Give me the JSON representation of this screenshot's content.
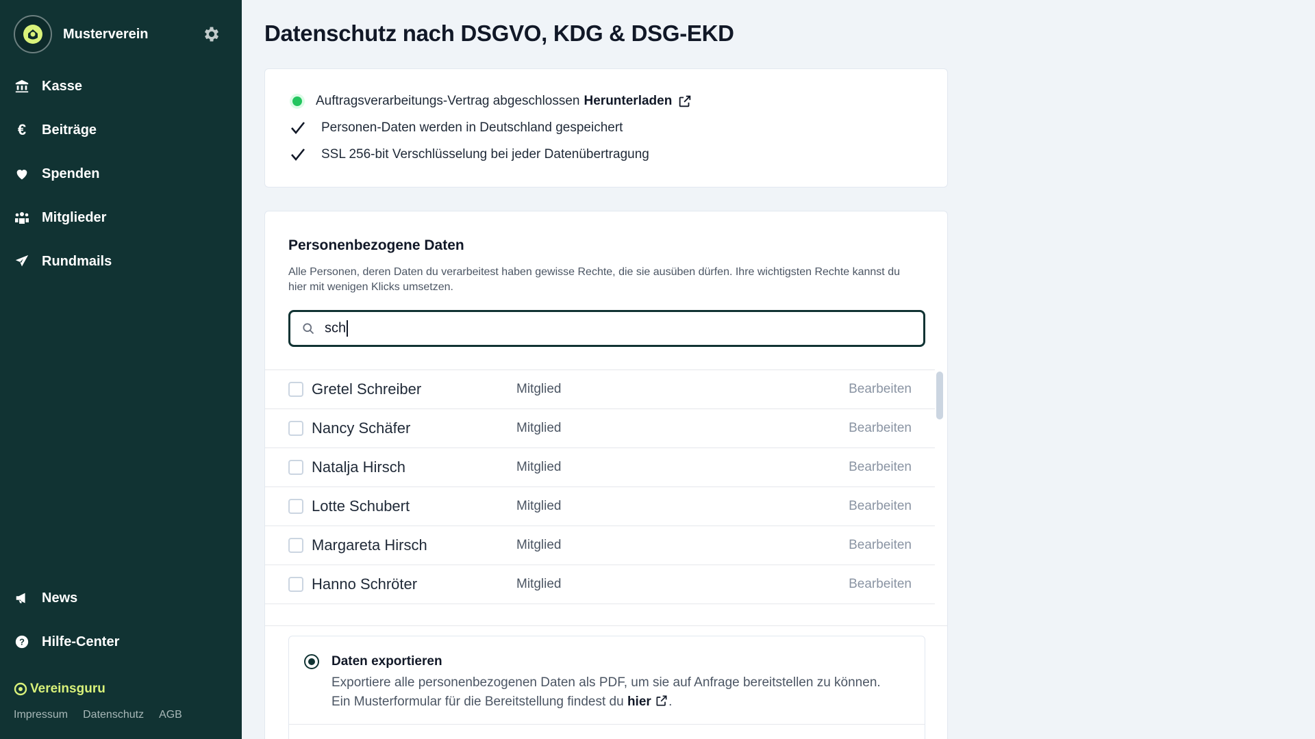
{
  "app": {
    "org_name": "Musterverein"
  },
  "sidebar": {
    "items": [
      {
        "label": "Kasse",
        "icon": "bank-icon"
      },
      {
        "label": "Beiträge",
        "icon": "euro-icon"
      },
      {
        "label": "Spenden",
        "icon": "heart-icon"
      },
      {
        "label": "Mitglieder",
        "icon": "members-icon"
      },
      {
        "label": "Rundmails",
        "icon": "send-icon"
      }
    ],
    "bottom_items": [
      {
        "label": "News",
        "icon": "megaphone-icon"
      },
      {
        "label": "Hilfe-Center",
        "icon": "help-icon"
      }
    ],
    "brand": "Vereinsguru",
    "footer_links": [
      "Impressum",
      "Datenschutz",
      "AGB"
    ]
  },
  "page": {
    "title": "Datenschutz nach DSGVO, KDG & DSG-EKD"
  },
  "features": {
    "avv_text": "Auftragsverarbeitungs-Vertrag abgeschlossen",
    "avv_link": "Herunterladen",
    "item1": "Personen-Daten werden in Deutschland gespeichert",
    "item2": "SSL 256-bit Verschlüsselung bei jeder Datenübertragung"
  },
  "personal_data": {
    "title": "Personenbezogene Daten",
    "description": "Alle Personen, deren Daten du verarbeitest haben gewisse Rechte, die sie ausüben dürfen. Ihre wichtigsten Rechte kannst du hier mit wenigen Klicks umsetzen.",
    "search_value": "sch",
    "edit_label": "Bearbeiten",
    "rows": [
      {
        "name": "Gretel Schreiber",
        "role": "Mitglied"
      },
      {
        "name": "Nancy Schäfer",
        "role": "Mitglied"
      },
      {
        "name": "Natalja Hirsch",
        "role": "Mitglied"
      },
      {
        "name": "Lotte Schubert",
        "role": "Mitglied"
      },
      {
        "name": "Margareta Hirsch",
        "role": "Mitglied"
      },
      {
        "name": "Hanno Schröter",
        "role": "Mitglied"
      }
    ]
  },
  "export_option": {
    "title": "Daten exportieren",
    "desc_before": "Exportiere alle personenbezogenen Daten als PDF, um sie auf Anfrage bereitstellen zu können. Ein Musterformular für die Bereitstellung findest du",
    "link": "hier",
    "desc_after": "."
  },
  "colors": {
    "sidebar_bg": "#113333",
    "accent_yellow": "#d9f27a",
    "status_green": "#22c55e"
  }
}
